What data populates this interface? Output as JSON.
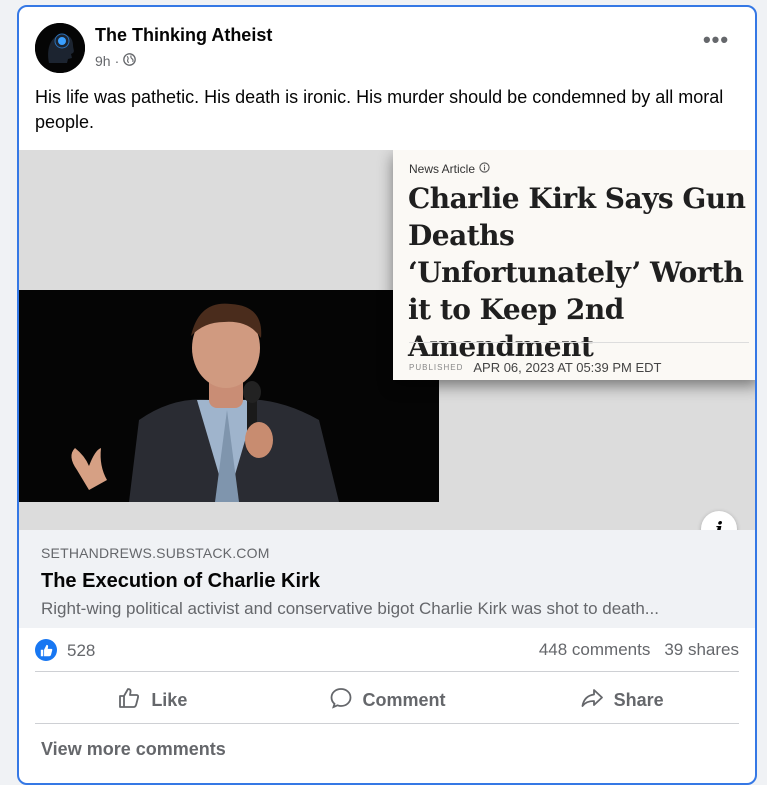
{
  "post": {
    "page_name": "The Thinking Atheist",
    "time": "9h",
    "separator": "·",
    "text": "His life was pathetic. His death is ironic. His murder should be condemned by all moral people."
  },
  "article": {
    "kicker": "News Article",
    "headline": "Charlie Kirk Says Gun Deaths ‘Unfortunately’ Worth it to Keep 2nd Amendment",
    "published_label": "PUBLISHED",
    "published_date": "APR 06, 2023 AT 05:39 PM EDT"
  },
  "link": {
    "domain": "SETHANDREWS.SUBSTACK.COM",
    "title": "The Execution of Charlie Kirk",
    "description": "Right-wing political activist and conservative bigot Charlie Kirk was shot to death..."
  },
  "engagement": {
    "likes": "528",
    "comments": "448 comments",
    "shares": "39 shares"
  },
  "actions": {
    "like": "Like",
    "comment": "Comment",
    "share": "Share"
  },
  "footer": {
    "view_more": "View more comments"
  },
  "info_icon": "i",
  "more_icon": "•••",
  "colors": {
    "accent": "#1877f2",
    "border": "#3578e5",
    "secondary_text": "#65676b"
  }
}
